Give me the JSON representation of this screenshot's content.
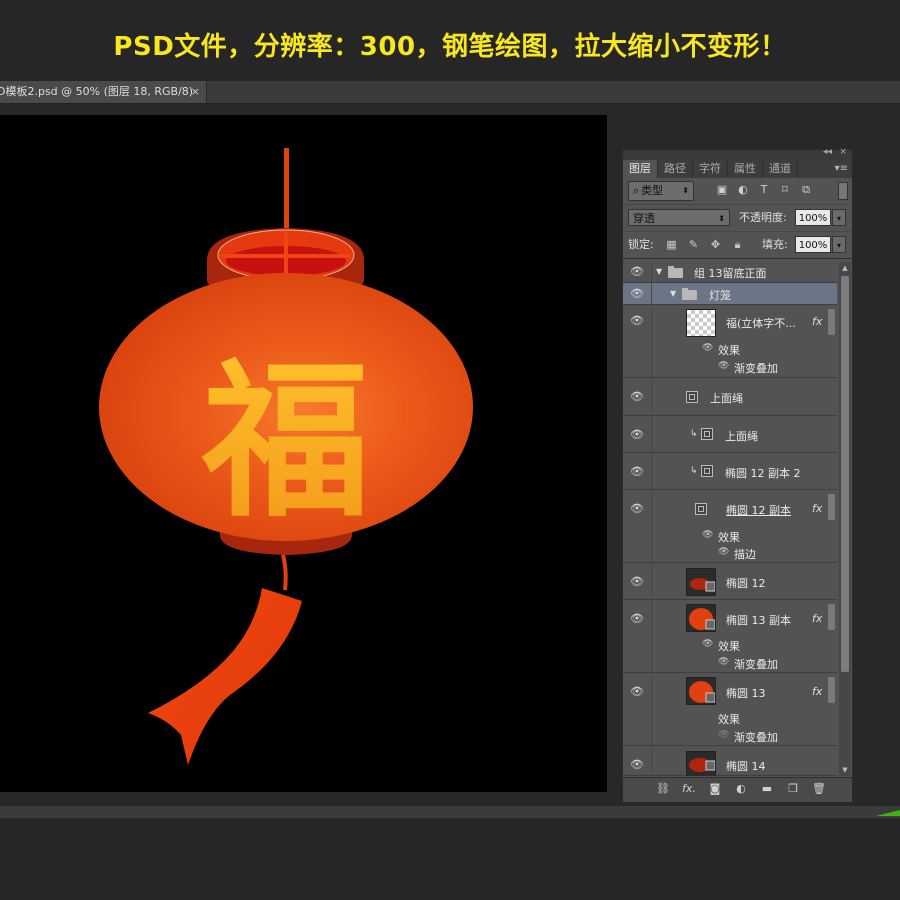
{
  "banner": {
    "text": "PSD文件，分辨率：300，钢笔绘图，拉大缩小不变形！",
    "color": "#f8e61e"
  },
  "document_tab": {
    "title": "D模板2.psd @ 50% (图层 18, RGB/8)",
    "close_glyph": "×"
  },
  "artwork": {
    "character": "福",
    "lantern_color": "#e2400e",
    "character_color": "#f7a41c"
  },
  "layers_panel": {
    "collapse_glyph": "◂◂",
    "close_glyph": "×",
    "menu_glyph": "▾≡",
    "tabs": [
      {
        "label": "图层",
        "active": true
      },
      {
        "label": "路径",
        "active": false
      },
      {
        "label": "字符",
        "active": false
      },
      {
        "label": "属性",
        "active": false
      },
      {
        "label": "通道",
        "active": false
      }
    ],
    "filter": {
      "kind_label": "类型",
      "kind_icon": "search-icon"
    },
    "blend_mode": "穿透",
    "opacity_label": "不透明度:",
    "opacity_value": "100%",
    "lock_label": "锁定:",
    "fill_label": "填充:",
    "fill_value": "100%",
    "layers": [
      {
        "name": "组 13留底正面",
        "type": "group"
      },
      {
        "name": "灯笼",
        "type": "group",
        "selected": true
      },
      {
        "name": "福(立体字不...",
        "type": "smart",
        "fx": "fx",
        "effects_label": "效果",
        "effects": [
          "渐变叠加"
        ]
      },
      {
        "name": "上面绳",
        "type": "shape"
      },
      {
        "name": "上面绳",
        "type": "shape"
      },
      {
        "name": "椭圆 12 副本 2",
        "type": "shape"
      },
      {
        "name": "椭圆 12 副本",
        "type": "shape",
        "fx": "fx",
        "effects_label": "效果",
        "effects": [
          "描边"
        ]
      },
      {
        "name": "椭圆 12",
        "type": "shape"
      },
      {
        "name": "椭圆 13 副本",
        "type": "shape",
        "fx": "fx",
        "effects_label": "效果",
        "effects": [
          "渐变叠加"
        ]
      },
      {
        "name": "椭圆 13",
        "type": "shape",
        "fx": "fx",
        "effects_label": "效果",
        "effects": [
          "渐变叠加"
        ]
      },
      {
        "name": "椭圆 14",
        "type": "shape"
      }
    ],
    "footer_icons": [
      "link-icon",
      "fx-icon",
      "mask-icon",
      "adjustment-icon",
      "new-group-icon",
      "new-layer-icon",
      "trash-icon"
    ]
  }
}
